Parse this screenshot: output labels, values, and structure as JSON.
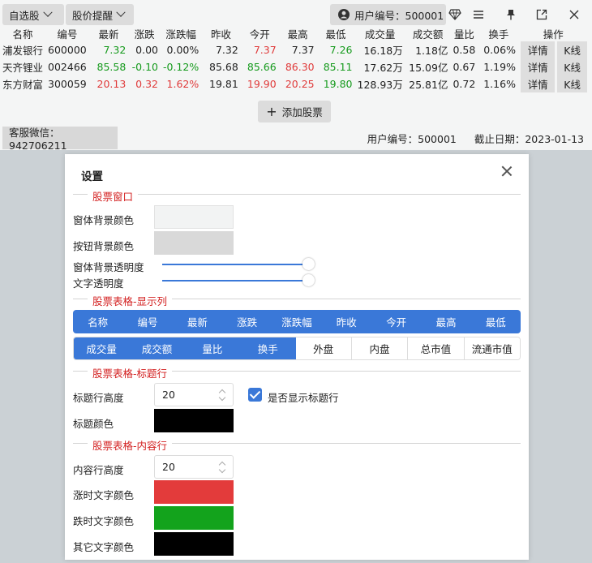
{
  "toolbar": {
    "watchlist_label": "自选股",
    "alert_label": "股价提醒",
    "user_label": "用户编号：500001"
  },
  "table": {
    "headers": [
      "名称",
      "编号",
      "最新",
      "涨跌",
      "涨跌幅",
      "昨收",
      "今开",
      "最高",
      "最低",
      "成交量",
      "成交额",
      "量比",
      "换手",
      "操作"
    ],
    "rows": [
      {
        "name": "浦发银行",
        "code": "600000",
        "latest": "7.32",
        "change": "0.00",
        "pct": "0.00%",
        "prev": "7.32",
        "open": "7.37",
        "high": "7.37",
        "low": "7.26",
        "volume": "16.18万",
        "amount": "1.18亿",
        "ratio": "0.58",
        "turnover": "0.06%",
        "detail": "详情",
        "kline": "K线"
      },
      {
        "name": "天齐锂业",
        "code": "002466",
        "latest": "85.58",
        "change": "-0.10",
        "pct": "-0.12%",
        "prev": "85.68",
        "open": "85.66",
        "high": "86.30",
        "low": "85.11",
        "volume": "17.62万",
        "amount": "15.09亿",
        "ratio": "0.67",
        "turnover": "1.19%",
        "detail": "详情",
        "kline": "K线"
      },
      {
        "name": "东方财富",
        "code": "300059",
        "latest": "20.13",
        "change": "0.32",
        "pct": "1.62%",
        "prev": "19.81",
        "open": "19.90",
        "high": "20.25",
        "low": "19.80",
        "volume": "128.93万",
        "amount": "25.81亿",
        "ratio": "0.72",
        "turnover": "1.16%",
        "detail": "详情",
        "kline": "K线"
      }
    ]
  },
  "add_stock_label": "添加股票",
  "status": {
    "wechat": "客服微信：942706211",
    "user": "用户编号：500001",
    "deadline": "截止日期：2023-01-13"
  },
  "dialog": {
    "title": "设置",
    "sections": {
      "window": "股票窗口",
      "columns": "股票表格-显示列",
      "header": "股票表格-标题行",
      "content": "股票表格-内容行"
    },
    "labels": {
      "window_bg": "窗体背景颜色",
      "button_bg": "按钮背景颜色",
      "window_opacity": "窗体背景透明度",
      "text_opacity": "文字透明度",
      "header_height": "标题行高度",
      "header_color": "标题颜色",
      "show_header": "是否显示标题行",
      "content_height": "内容行高度",
      "up_color": "涨时文字颜色",
      "down_color": "跌时文字颜色",
      "other_color": "其它文字颜色"
    },
    "values": {
      "header_height": "20",
      "content_height": "20"
    },
    "colors": {
      "window_bg": "#f2f3f3",
      "button_bg": "#d9d9d9",
      "header_color": "#000000",
      "up_color": "#e33b3b",
      "down_color": "#13a31c",
      "other_color": "#000000"
    },
    "columns_row1": [
      "名称",
      "编号",
      "最新",
      "涨跌",
      "涨跌幅",
      "昨收",
      "今开",
      "最高",
      "最低"
    ],
    "columns_row2_on": [
      "成交量",
      "成交额",
      "量比",
      "换手"
    ],
    "columns_row2_off": [
      "外盘",
      "内盘",
      "总市值",
      "流通市值"
    ]
  }
}
